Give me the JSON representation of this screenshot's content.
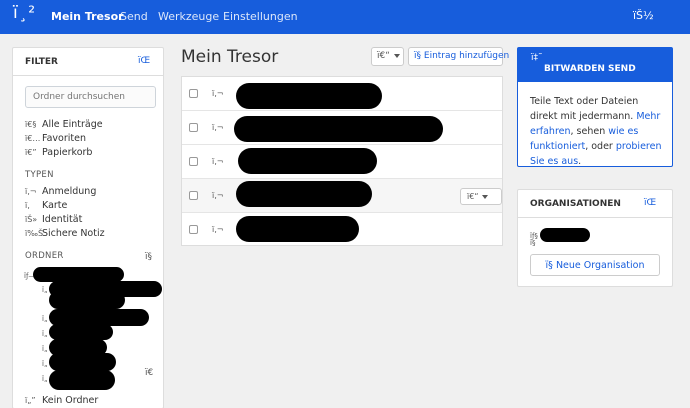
{
  "nav": {
    "logo": "ï¸²",
    "items": [
      "Mein Tresor",
      "Send",
      "Werkzeuge",
      "Einstellungen"
    ],
    "account_icon": "ïŠ½"
  },
  "filter": {
    "title": "FILTER",
    "help_icon": "ïŒ",
    "search_placeholder": "Ordner durchsuchen",
    "all": {
      "icon": "ï€§",
      "label": "Alle Einträge"
    },
    "favorites": {
      "icon": "ï€…",
      "label": "Favoriten"
    },
    "trash": {
      "icon": "ï€”",
      "label": "Papierkorb"
    },
    "types_title": "TYPEN",
    "types": [
      {
        "icon": "ï‚¬",
        "label": "Anmeldung"
      },
      {
        "icon": "ï‚",
        "label": "Karte"
      },
      {
        "icon": "ïŠ»",
        "label": "Identität"
      },
      {
        "icon": "ï‰Š",
        "label": "Sichere Notiz"
      }
    ],
    "folders_title": "ORDNER",
    "folders_add_icon": "ï§",
    "folder_tree_icons": [
      "ïƒ—",
      "ï„",
      "ï„",
      "ï„",
      "ï„",
      "ï„",
      "ï„"
    ],
    "folder_edit_icon": "ï€",
    "no_folder": {
      "icon": "ï„”",
      "label": "Kein Ordner"
    }
  },
  "main": {
    "title": "Mein Tresor",
    "cog_icon": "ï€“",
    "add_button": {
      "icon": "ï§",
      "label": "Eintrag hinzufügen"
    },
    "row_icon": "ï‚¬",
    "row_menu_icon": "ï€“"
  },
  "send": {
    "icon": "ï‡˜",
    "title": "BITWARDEN SEND",
    "text1": "Teile Text oder Dateien direkt mit jedermann. ",
    "link1": "Mehr erfahren",
    "text2": ", sehen ",
    "link2": "wie es funktioniert",
    "text3": ", oder ",
    "link3": "probieren Sie es aus",
    "text4": "."
  },
  "orgs": {
    "title": "ORGANISATIONEN",
    "help_icon": "ïŒ",
    "item_icon": "ïƒ§",
    "item_icon2": "ï§",
    "new_icon": "ï§",
    "new_label": "Neue Organisation"
  },
  "colors": {
    "brand": "#175ddc",
    "background": "#f0f0f0"
  }
}
